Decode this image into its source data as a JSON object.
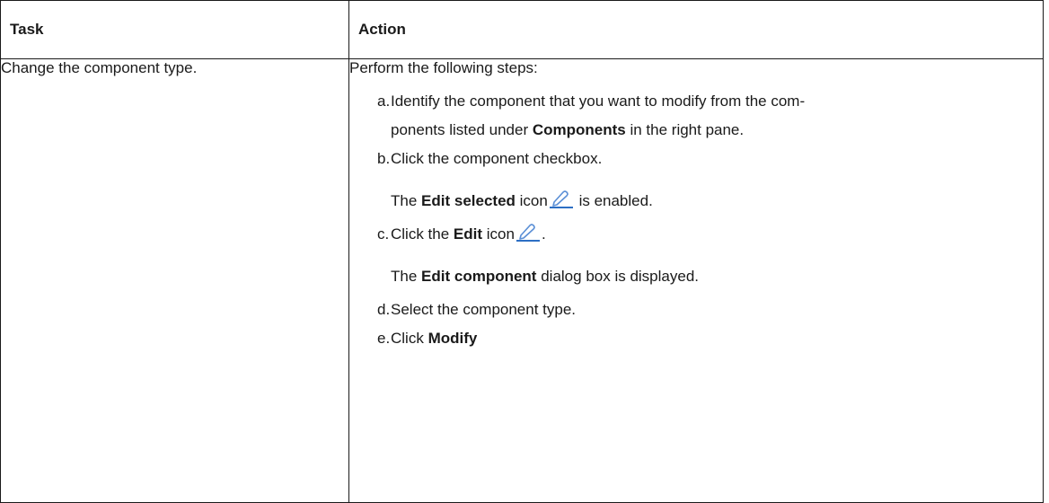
{
  "table": {
    "headers": {
      "task": "Task",
      "action": "Action"
    },
    "row": {
      "task": "Change the component type.",
      "action_intro": "Perform the following steps:",
      "steps": {
        "a": {
          "marker": "a.",
          "text_pre": "Identify the component that you want to modify from the com-",
          "text_line2_pre": "ponents listed under",
          "bold": "Components",
          "text_post": "in the right pane."
        },
        "b": {
          "marker": "b.",
          "text": "Click the component checkbox.",
          "note_pre": "The",
          "note_bold": "Edit selected",
          "note_mid": "icon",
          "note_post": "is enabled.",
          "note_icon": "pencil-edit-icon"
        },
        "c": {
          "marker": "c.",
          "text_pre": "Click the",
          "bold": "Edit",
          "text_mid": "icon",
          "text_post": ".",
          "icon": "pencil-edit-icon",
          "note_pre": "The",
          "note_bold": "Edit component",
          "note_post": "dialog box is displayed."
        },
        "d": {
          "marker": "d.",
          "text": "Select the component type."
        },
        "e": {
          "marker": "e.",
          "text_pre": "Click",
          "bold": "Modify"
        }
      }
    }
  },
  "colors": {
    "icon_stroke": "#5b8fd6",
    "icon_underline": "#2d6fc4",
    "border": "#1a1a1a"
  }
}
